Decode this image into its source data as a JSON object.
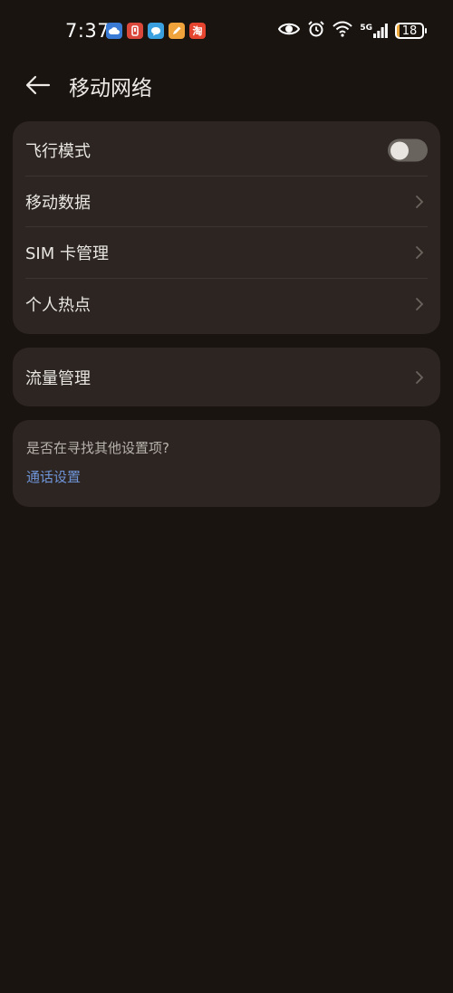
{
  "status_bar": {
    "time": "7:37",
    "battery": "18",
    "network": "5G",
    "app_icons": [
      {
        "name": "weather-app-icon",
        "color": "#3a7bd5",
        "glyph": "☁"
      },
      {
        "name": "red-app-icon",
        "color": "#d9483b",
        "glyph": "▯"
      },
      {
        "name": "message-app-icon",
        "color": "#3aa0e0",
        "glyph": "●"
      },
      {
        "name": "note-app-icon",
        "color": "#f0a23b",
        "glyph": "✎"
      },
      {
        "name": "taobao-app-icon",
        "color": "#e5452f",
        "glyph": "淘"
      }
    ]
  },
  "header": {
    "title": "移动网络"
  },
  "settings": {
    "airplane_mode": {
      "label": "飞行模式",
      "enabled": false
    },
    "items": [
      {
        "label": "移动数据"
      },
      {
        "label": "SIM 卡管理"
      },
      {
        "label": "个人热点"
      }
    ],
    "data_management": {
      "label": "流量管理"
    }
  },
  "hint": {
    "question": "是否在寻找其他设置项?",
    "link": "通话设置"
  },
  "colors": {
    "background": "#1a1410",
    "card": "#2c2521",
    "link": "#6f94d8"
  }
}
